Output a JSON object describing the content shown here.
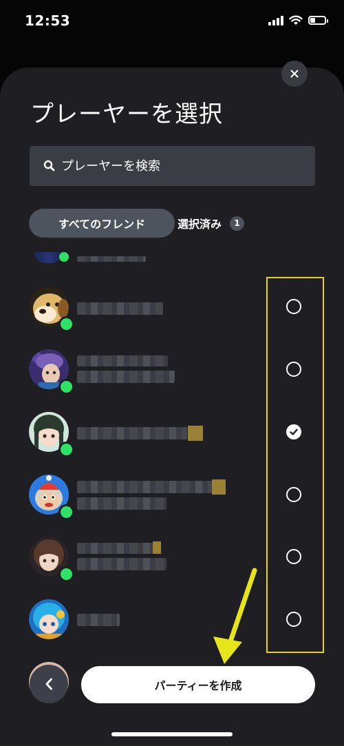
{
  "status_bar": {
    "time": "12:53"
  },
  "sheet": {
    "title": "プレーヤーを選択",
    "search": {
      "placeholder": "プレーヤーを検索",
      "value": ""
    },
    "tabs": {
      "all_friends": "すべてのフレンド",
      "selected": "選択済み",
      "selected_count": "1"
    },
    "friends": [
      {
        "avatar": "dog-avatar",
        "online": true,
        "selected": false
      },
      {
        "avatar": "purple-hair-character-avatar",
        "online": true,
        "selected": false
      },
      {
        "avatar": "dark-hair-girl-avatar",
        "online": true,
        "selected": true
      },
      {
        "avatar": "monkey-avatar",
        "online": true,
        "selected": false
      },
      {
        "avatar": "brown-hair-girl-avatar",
        "online": true,
        "selected": false
      },
      {
        "avatar": "blue-hair-character-avatar",
        "online": false,
        "selected": false
      }
    ],
    "create_party_label": "パーティーを作成"
  },
  "colors": {
    "sheet_bg": "#1e1e23",
    "online": "#2fe167",
    "highlight": "#e6d51a"
  }
}
